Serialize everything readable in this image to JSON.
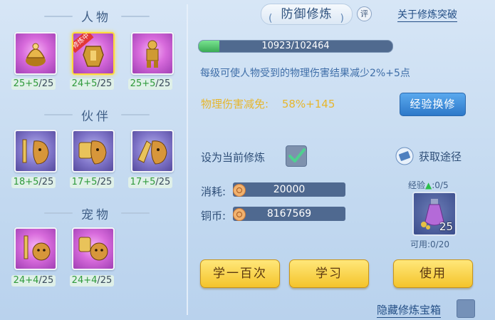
{
  "left_panel": {
    "sections": [
      {
        "title": "人物",
        "slots": [
          {
            "icon": "character-helmet-icon",
            "level_a": "25+5",
            "level_b": "/25",
            "selected": false
          },
          {
            "icon": "character-armor-icon",
            "level_a": "24+5",
            "level_b": "/25",
            "selected": true,
            "badge": "修炼中"
          },
          {
            "icon": "character-body-icon",
            "level_a": "25+5",
            "level_b": "/25",
            "selected": false
          }
        ]
      },
      {
        "title": "伙伴",
        "slots": [
          {
            "icon": "partner-sword-icon",
            "level_a": "18+5",
            "level_b": "/25"
          },
          {
            "icon": "partner-shield-icon",
            "level_a": "17+5",
            "level_b": "/25"
          },
          {
            "icon": "partner-gauntlet-icon",
            "level_a": "17+5",
            "level_b": "/25"
          }
        ]
      },
      {
        "title": "宠物",
        "slots": [
          {
            "icon": "pet-sword-icon",
            "level_a": "24+4",
            "level_b": "/25"
          },
          {
            "icon": "pet-shield-icon",
            "level_a": "24+4",
            "level_b": "/25"
          }
        ]
      }
    ]
  },
  "header": {
    "tab_label": "防御修炼",
    "eval_label": "评",
    "about_link": "关于修炼突破"
  },
  "progress": {
    "text": "10923/102464",
    "fraction": 0.1066
  },
  "description": "每级可使人物受到的物理伤害结果减少2%+5点",
  "damage": {
    "label": "物理伤害减免:",
    "value": "58%+145"
  },
  "exchange_button": "经验换修",
  "set_current": {
    "label": "设为当前修炼",
    "checked": true
  },
  "obtain": {
    "label": "获取途径",
    "icon": "book-icon"
  },
  "costs": {
    "consume_label": "消耗:",
    "consume_value": "20000",
    "coins_label": "铜币:",
    "coins_value": "8167569"
  },
  "item": {
    "exp_label": "经验",
    "exp_value": ":0/5",
    "count": "25",
    "usable": "可用:0/20",
    "icon": "potion-icon"
  },
  "buttons": {
    "learn_100": "学一百次",
    "learn": "学习",
    "use": "使用"
  },
  "hidden_box_label": "隐藏修炼宝箱",
  "colors": {
    "accent_yellow": "#f4c42b",
    "accent_blue": "#2d78c9",
    "level_green": "#2f9a3b",
    "damage_gold": "#e6b62d"
  }
}
